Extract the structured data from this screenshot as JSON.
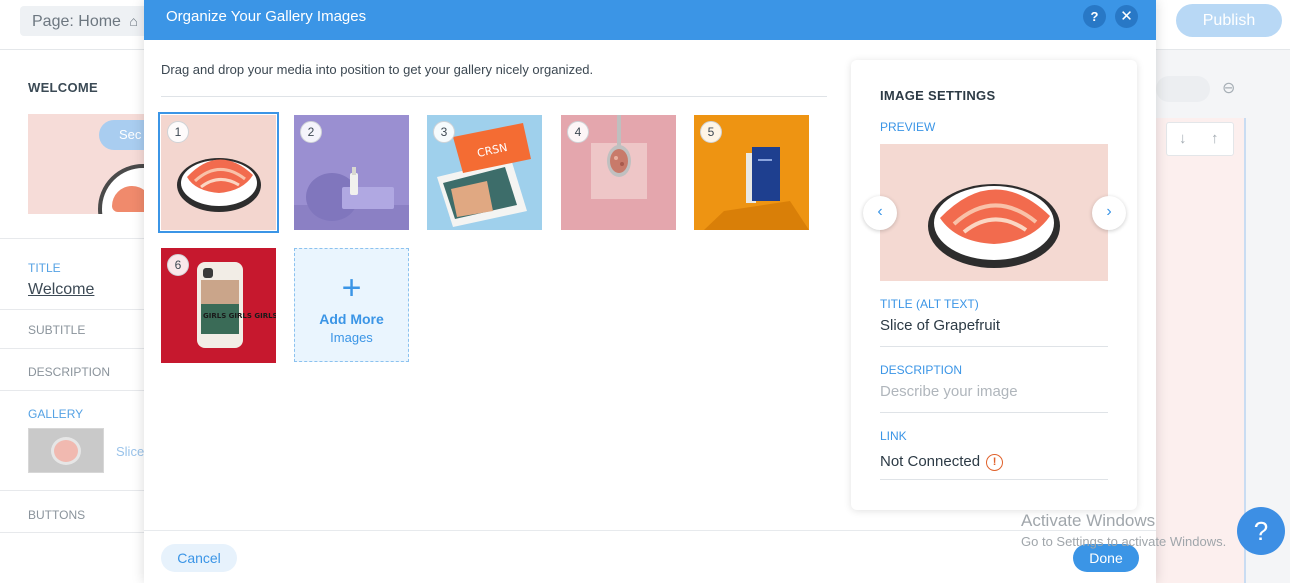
{
  "editor": {
    "page_label": "Page: Home",
    "publish_label": "Publish",
    "left_panel": {
      "heading": "WELCOME",
      "preview_button": "Sec",
      "title_label": "TITLE",
      "title_value": "Welcome",
      "subtitle_label": "SUBTITLE",
      "description_label": "DESCRIPTION",
      "gallery_label": "GALLERY",
      "gallery_item_text": "Slice",
      "buttons_label": "BUTTONS"
    },
    "watermark": {
      "line1": "Activate Windows",
      "line2": "Go to Settings to activate Windows."
    },
    "help_fab": "?"
  },
  "modal": {
    "title": "Organize Your Gallery Images",
    "help_icon": "?",
    "close_icon": "✕",
    "instructions": "Drag and drop your media into position to get your gallery nicely organized.",
    "tiles": [
      {
        "num": "1",
        "bg": "#f3d6cf"
      },
      {
        "num": "2",
        "bg": "#9a8fd1"
      },
      {
        "num": "3",
        "bg": "#9fd0ec"
      },
      {
        "num": "4",
        "bg": "#e4a6ad"
      },
      {
        "num": "5",
        "bg": "#ee9412"
      },
      {
        "num": "6",
        "bg": "#c6182e"
      }
    ],
    "tile3_box_text": "CRSN",
    "tile6_case_text": "GIRLS GIRLS GIRLS",
    "add_more": {
      "line1": "Add More",
      "line2": "Images"
    },
    "settings": {
      "heading": "IMAGE SETTINGS",
      "preview_label": "PREVIEW",
      "title_label": "TITLE (ALT TEXT)",
      "title_value": "Slice of Grapefruit",
      "description_label": "DESCRIPTION",
      "description_placeholder": "Describe your image",
      "link_label": "LINK",
      "link_value": "Not Connected"
    },
    "cancel_label": "Cancel",
    "done_label": "Done"
  },
  "colors": {
    "accent": "#3b95e6",
    "warning": "#e0622c"
  }
}
